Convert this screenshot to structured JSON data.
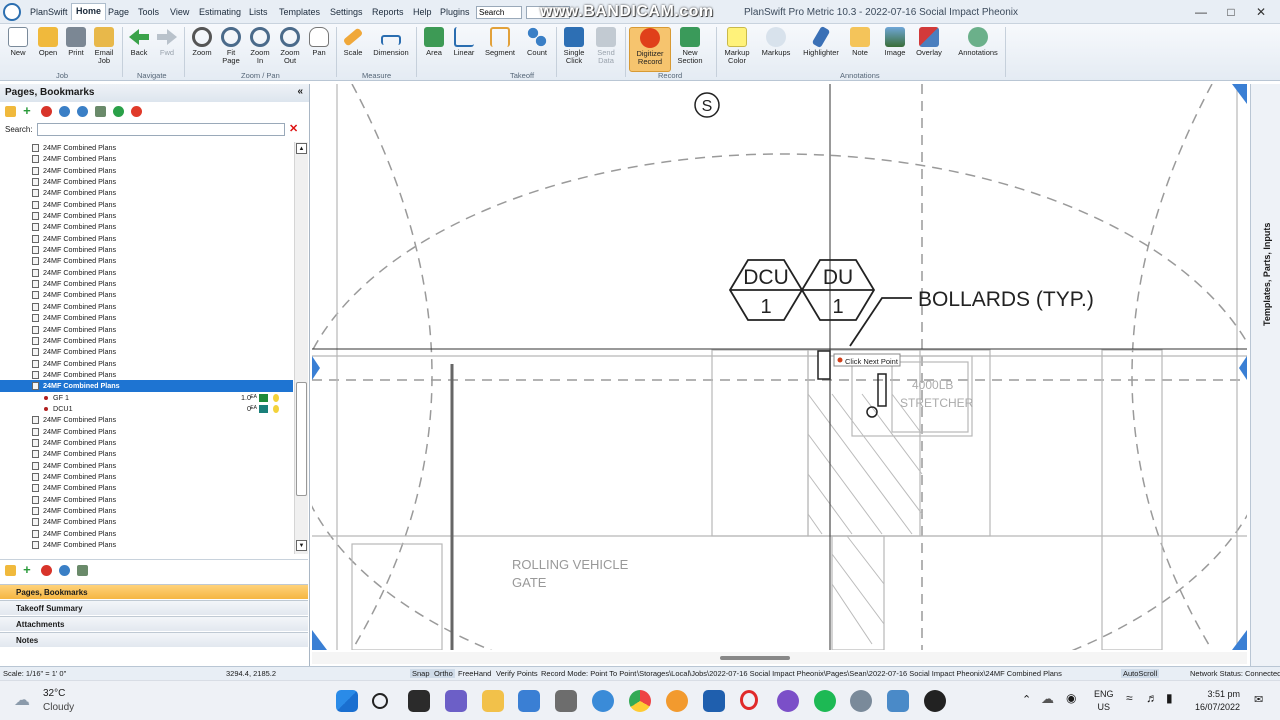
{
  "app": {
    "menu_tabs": [
      "PlanSwift",
      "Home",
      "Page",
      "Tools",
      "View",
      "Estimating",
      "Lists",
      "Templates",
      "Settings",
      "Reports",
      "Help",
      "Plugins"
    ],
    "search_placeholder": "Search",
    "watermark": "www.BANDICAM.com",
    "window_title": "PlanSwift Pro Metric 10.3 - 2022-07-16 Social Impact Pheonix"
  },
  "ribbon": {
    "buttons": [
      {
        "label": "New",
        "icon": "new-document-icon"
      },
      {
        "label": "Open",
        "icon": "folder-open-icon"
      },
      {
        "label": "Print",
        "icon": "printer-icon"
      },
      {
        "label": "Email\nJob",
        "icon": "email-icon"
      },
      {
        "label": "Back",
        "icon": "arrow-left-icon"
      },
      {
        "label": "Fwd",
        "icon": "arrow-right-icon"
      },
      {
        "label": "Zoom",
        "icon": "magnifier-icon"
      },
      {
        "label": "Fit\nPage",
        "icon": "zoom-fit-icon"
      },
      {
        "label": "Zoom\nIn",
        "icon": "zoom-in-icon"
      },
      {
        "label": "Zoom\nOut",
        "icon": "zoom-out-icon"
      },
      {
        "label": "Pan",
        "icon": "hand-icon"
      },
      {
        "label": "Scale",
        "icon": "ruler-icon"
      },
      {
        "label": "Dimension",
        "icon": "dimension-icon"
      },
      {
        "label": "Area",
        "icon": "area-icon"
      },
      {
        "label": "Linear",
        "icon": "linear-icon"
      },
      {
        "label": "Segment",
        "icon": "segment-icon"
      },
      {
        "label": "Count",
        "icon": "count-icon"
      },
      {
        "label": "Single\nClick",
        "icon": "single-click-icon"
      },
      {
        "label": "Send\nData",
        "icon": "send-data-icon"
      },
      {
        "label": "Digitizer\nRecord",
        "icon": "record-icon"
      },
      {
        "label": "New\nSection",
        "icon": "new-section-icon"
      },
      {
        "label": "Markup\nColor",
        "icon": "markup-color-icon"
      },
      {
        "label": "Markups",
        "icon": "cloud-icon"
      },
      {
        "label": "Highlighter",
        "icon": "highlighter-icon"
      },
      {
        "label": "Note",
        "icon": "note-icon"
      },
      {
        "label": "Image",
        "icon": "image-icon"
      },
      {
        "label": "Overlay",
        "icon": "overlay-icon"
      },
      {
        "label": "Annotations",
        "icon": "annotations-icon"
      }
    ],
    "groups": [
      "Job",
      "Navigate",
      "Zoom / Pan",
      "Measure",
      "Takeoff",
      "Record",
      "Annotations"
    ]
  },
  "left_panel": {
    "title": "Pages, Bookmarks",
    "search_label": "Search:",
    "tree": {
      "page_label": "24MF Combined Plans",
      "rows_before": 21,
      "selected_label": "24MF Combined Plans",
      "children": [
        {
          "label": "GF 1",
          "qty": "1.0",
          "unit": "EA",
          "color": "#1e8a3a"
        },
        {
          "label": "DCU1",
          "qty": "0",
          "unit": "EA",
          "color": "#1a7f7a"
        }
      ],
      "rows_after": 12
    },
    "accordion": [
      "Pages, Bookmarks",
      "Takeoff Summary",
      "Attachments",
      "Notes"
    ]
  },
  "drawing": {
    "symbol_s": "S",
    "tag_dcu": "DCU",
    "tag_du": "DU",
    "tag_num": "1",
    "callout_bollards": "BOLLARDS (TYP.)",
    "tooltip": "Click Next Point",
    "room_text_1": "4000LB",
    "room_text_2": "STRETCHER",
    "gate_text_1": "ROLLING VEHICLE",
    "gate_text_2": "GATE"
  },
  "right_strip": {
    "label": "Templates, Parts, Inputs"
  },
  "statusbar": {
    "scale": "Scale: 1/16\" = 1' 0\"",
    "coords": "3294.4, 2185.2",
    "snap": "Snap",
    "ortho": "Ortho",
    "freehand": "FreeHand",
    "verify": "Verify Points",
    "record_mode": "Record Mode: Point To Point",
    "path": "\\Storages\\Local\\Jobs\\2022-07-16 Social Impact Pheonix\\Pages\\Sean\\2022-07-16 Social Impact Pheonix\\24MF Combined Plans",
    "autoscroll": "AutoScroll",
    "network": "Network Status: Connected"
  },
  "taskbar": {
    "temp": "32°C",
    "weather": "Cloudy",
    "lang1": "ENG",
    "lang2": "US",
    "time": "3:51 pm",
    "date": "16/07/2022"
  }
}
